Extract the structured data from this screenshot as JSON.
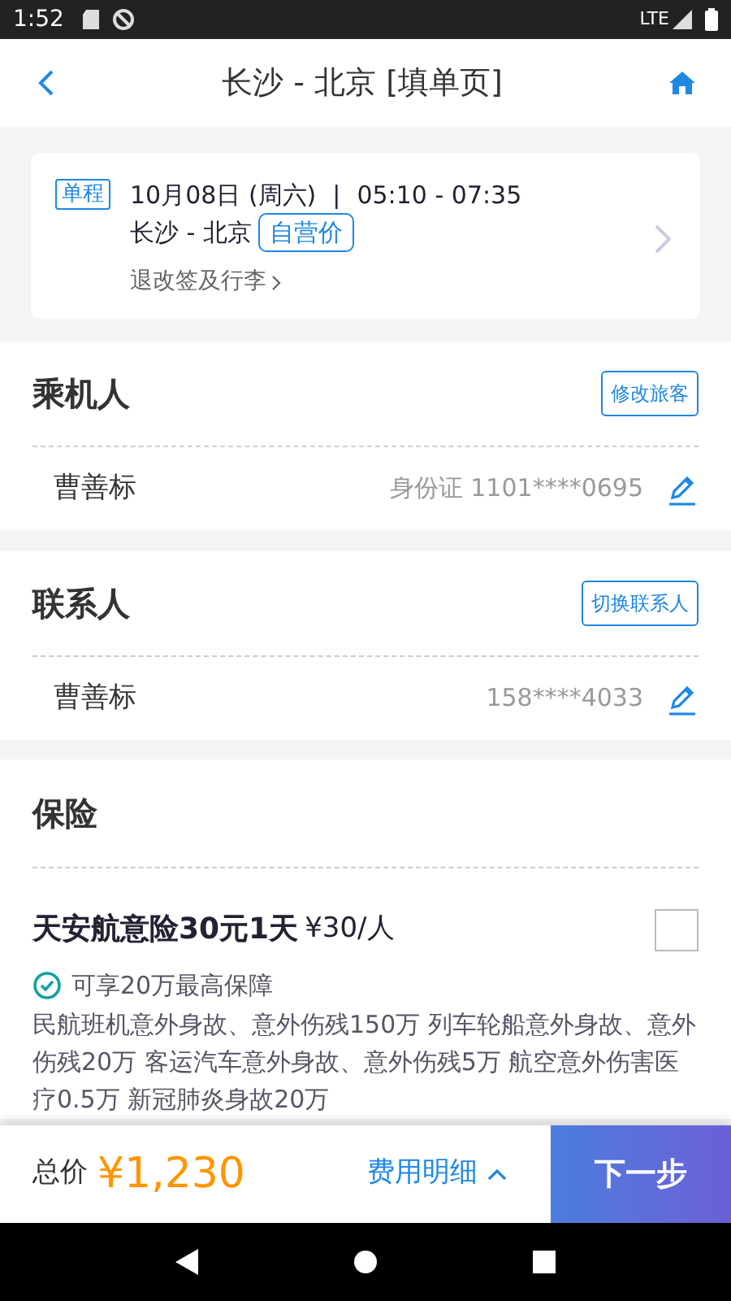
{
  "status_bar": {
    "time": "1:52",
    "network": "LTE"
  },
  "header": {
    "title": "长沙 - 北京 [填单页]"
  },
  "flight": {
    "trip_type": "单程",
    "date": "10月08日 (周六)",
    "separator": "|",
    "time": "05:10 - 07:35",
    "route": "长沙 - 北京",
    "price_tag": "自营价",
    "policy_link": "退改签及行李"
  },
  "passengers": {
    "title": "乘机人",
    "action": "修改旅客",
    "rows": [
      {
        "name": "曹善标",
        "detail": "身份证 1101****0695"
      }
    ]
  },
  "contacts": {
    "title": "联系人",
    "action": "切换联系人",
    "rows": [
      {
        "name": "曹善标",
        "detail": "158****4033"
      }
    ]
  },
  "insurance": {
    "title": "保险",
    "items": [
      {
        "name": "天安航意险30元1天",
        "price": "¥30/人",
        "checked": false,
        "highlight": "可享20万最高保障",
        "description": "民航班机意外身故、意外伤残150万 列车轮船意外身故、意外伤残20万  客运汽车意外身故、意外伤残5万 航空意外伤害医疗0.5万  新冠肺炎身故20万"
      }
    ]
  },
  "footer": {
    "total_label": "总价",
    "total": "¥1,230",
    "details_link": "费用明细",
    "next_button": "下一步"
  }
}
